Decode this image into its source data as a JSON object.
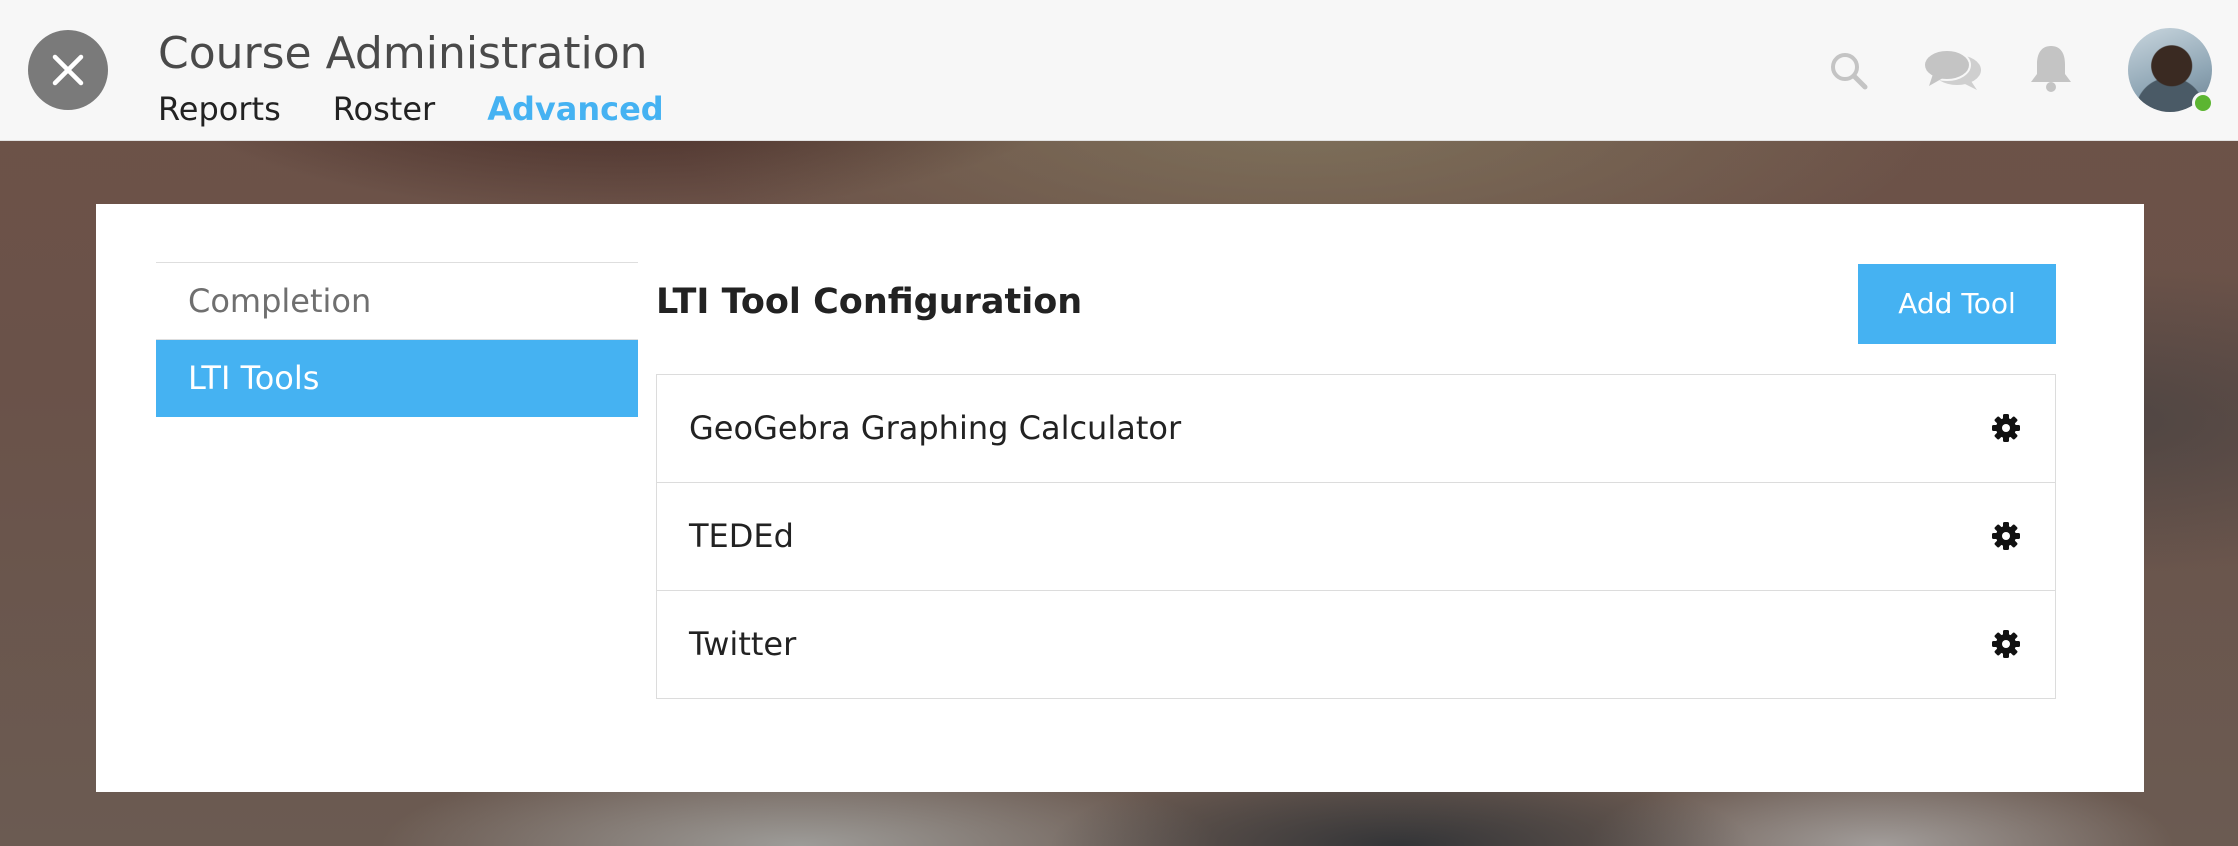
{
  "header": {
    "title": "Course Administration",
    "close_icon": "close-icon",
    "tabs": [
      {
        "label": "Reports",
        "active": false
      },
      {
        "label": "Roster",
        "active": false
      },
      {
        "label": "Advanced",
        "active": true
      }
    ],
    "icons": [
      "search-icon",
      "chat-icon",
      "bell-icon"
    ],
    "user_status": "online"
  },
  "sidebar": {
    "items": [
      {
        "label": "Completion",
        "active": false
      },
      {
        "label": "LTI Tools",
        "active": true
      }
    ]
  },
  "main": {
    "title": "LTI Tool Configuration",
    "add_button_label": "Add Tool",
    "tools": [
      {
        "name": "GeoGebra Graphing Calculator",
        "icon": "gear-icon"
      },
      {
        "name": "TEDEd",
        "icon": "gear-icon"
      },
      {
        "name": "Twitter",
        "icon": "gear-icon"
      }
    ]
  },
  "colors": {
    "accent": "#45b2f2",
    "status_online": "#5cb531",
    "close_button": "#7a7a7a"
  }
}
